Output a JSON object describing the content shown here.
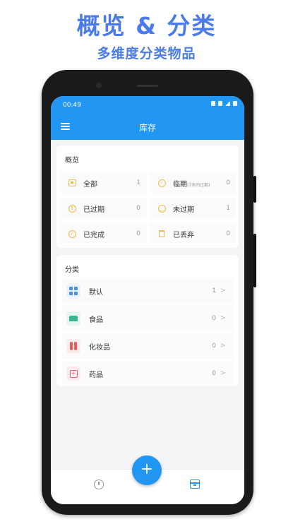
{
  "promo": {
    "headline": "概览 & 分类",
    "subline": "多维度分类物品"
  },
  "statusbar": {
    "time": "00:49"
  },
  "appbar": {
    "title": "库存"
  },
  "overview": {
    "title": "概览",
    "items": [
      {
        "label": "全部",
        "count": "1",
        "icon": "inbox-icon"
      },
      {
        "label": "临期",
        "note": "(7天内过期)",
        "count": "0",
        "icon": "alarm-icon"
      },
      {
        "label": "已过期",
        "count": "0",
        "icon": "alert-icon"
      },
      {
        "label": "未过期",
        "count": "1",
        "icon": "smile-icon"
      },
      {
        "label": "已完成",
        "count": "0",
        "icon": "check-icon"
      },
      {
        "label": "已丢弃",
        "count": "0",
        "icon": "trash-icon"
      }
    ]
  },
  "categories": {
    "title": "分类",
    "items": [
      {
        "label": "默认",
        "count": "1",
        "icon": "grid-icon"
      },
      {
        "label": "食品",
        "count": "0",
        "icon": "food-icon"
      },
      {
        "label": "化妆品",
        "count": "0",
        "icon": "cosmetics-icon"
      },
      {
        "label": "药品",
        "count": "0",
        "icon": "medicine-icon"
      }
    ]
  },
  "fab": {
    "label": "+"
  },
  "colors": {
    "accent": "#2196f3",
    "headline": "#4a7be8",
    "warning": "#f5b93f"
  }
}
